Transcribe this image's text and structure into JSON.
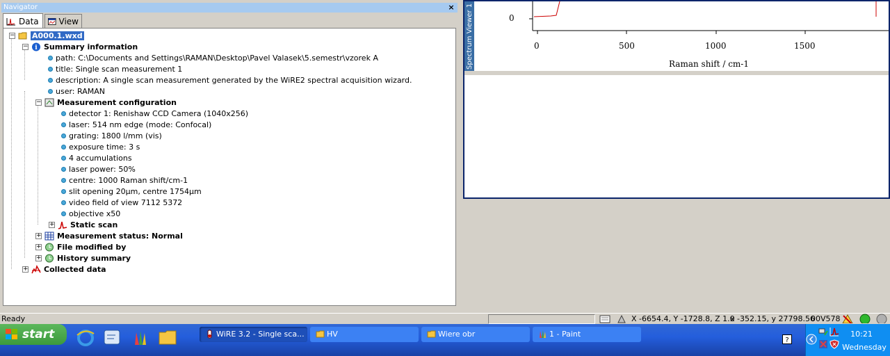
{
  "navigator": {
    "title": "Navigator",
    "close": "×",
    "tabs": [
      {
        "label": "Data"
      },
      {
        "label": "View"
      }
    ],
    "tree": {
      "root": "A000.1.wxd",
      "summary_title": "Summary information",
      "summary_items": [
        "path: C:\\Documents and Settings\\RAMAN\\Desktop\\Pavel Valasek\\5.semestr\\vzorek A",
        "title: Single scan measurement 1",
        "description: A single scan measurement generated by the WiRE2 spectral acquisition wizard.",
        "user: RAMAN"
      ],
      "config_title": "Measurement configuration",
      "config_items": [
        "detector 1: Renishaw CCD Camera (1040x256)",
        "laser: 514 nm edge (mode: Confocal)",
        "grating: 1800 l/mm (vis)",
        "exposure time: 3 s",
        "4 accumulations",
        "laser power: 50%",
        "centre: 1000 Raman shift/cm-1",
        "slit opening 20µm, centre 1754µm",
        "video field of view 7112 5372",
        "objective x50"
      ],
      "static_scan": "Static scan",
      "status": "Measurement status: Normal",
      "file_modified": "File modified by",
      "history": "History summary",
      "collected": "Collected data"
    }
  },
  "spectrum_viewer": {
    "side_label": "Spectrum Viewer 1",
    "y_tick": "0",
    "x_ticks": [
      "0",
      "500",
      "1000",
      "1500"
    ],
    "x_label": "Raman shift / cm-1",
    "line_color": "#cc0000"
  },
  "status_bar": {
    "left": "Ready",
    "coords": "X -6654.4, Y -1728.8, Z 1.0",
    "cursor": "x -352.15, y 27798.56",
    "code": "00V578"
  },
  "taskbar": {
    "start": "start",
    "buttons": [
      {
        "label": "WiRE 3.2 - Single sca..."
      },
      {
        "label": "HV"
      },
      {
        "label": "Wiere obr"
      },
      {
        "label": "1 - Paint"
      }
    ],
    "clock_time": "10:21",
    "clock_day": "Wednesday"
  }
}
